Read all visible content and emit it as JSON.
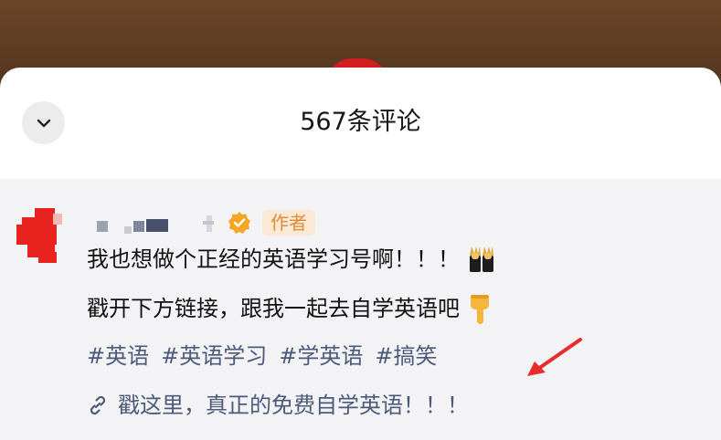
{
  "header": {
    "title": "567条评论"
  },
  "comment": {
    "author_badge": "作者",
    "line1": "我也想做个正经的英语学习号啊！！！",
    "line2": "戳开下方链接，跟我一起去自学英语吧",
    "tags": [
      "#英语",
      "#英语学习",
      "#学英语",
      "#搞笑"
    ],
    "link_text": "戳这里，真正的免费自学英语！！！"
  },
  "icons": {
    "collapse": "chevron-down-icon",
    "verified": "verified-check-icon",
    "link": "link-icon",
    "twins_emoji": "people-with-bunny-ears-emoji",
    "point_down_emoji": "pointing-down-emoji"
  },
  "colors": {
    "tag": "#4c5a7a",
    "badge_bg": "#fbe9d6",
    "badge_text": "#e08a35",
    "verified": "#f5a623",
    "arrow": "#e82c2c"
  }
}
